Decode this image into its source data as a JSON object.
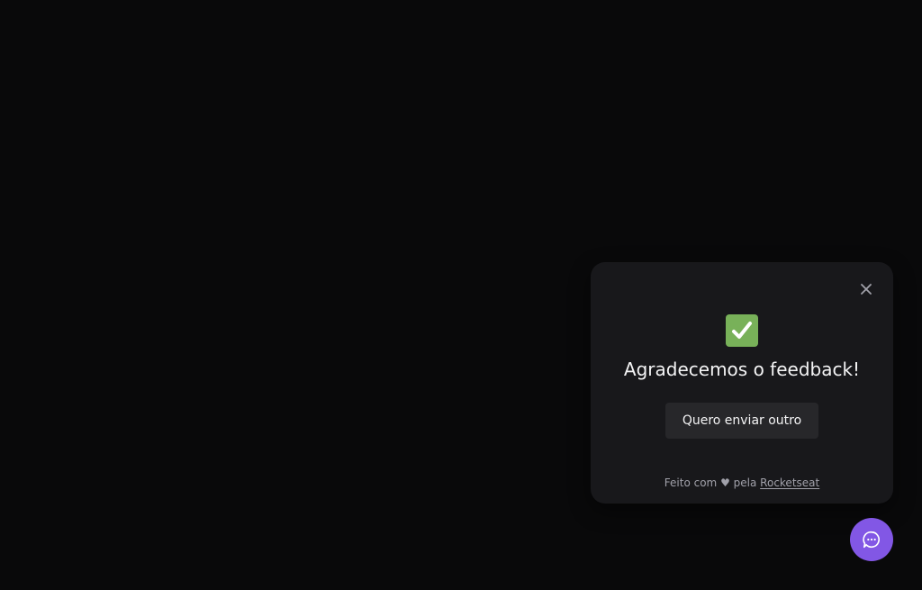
{
  "colors": {
    "background": "#09090a",
    "card": "#18181b",
    "button": "#27272a",
    "brand": "#8257e5",
    "success": "#78b159"
  },
  "feedback_widget": {
    "close_icon": "close-icon",
    "success_icon": "check-box-icon",
    "title": "Agradecemos o feedback!",
    "send_again_label": "Quero enviar outro",
    "footer": {
      "prefix": "Feito com",
      "heart": "♥",
      "middle": "pela",
      "link_label": "Rocketseat"
    }
  },
  "launcher": {
    "icon": "chat-bubble-icon"
  }
}
